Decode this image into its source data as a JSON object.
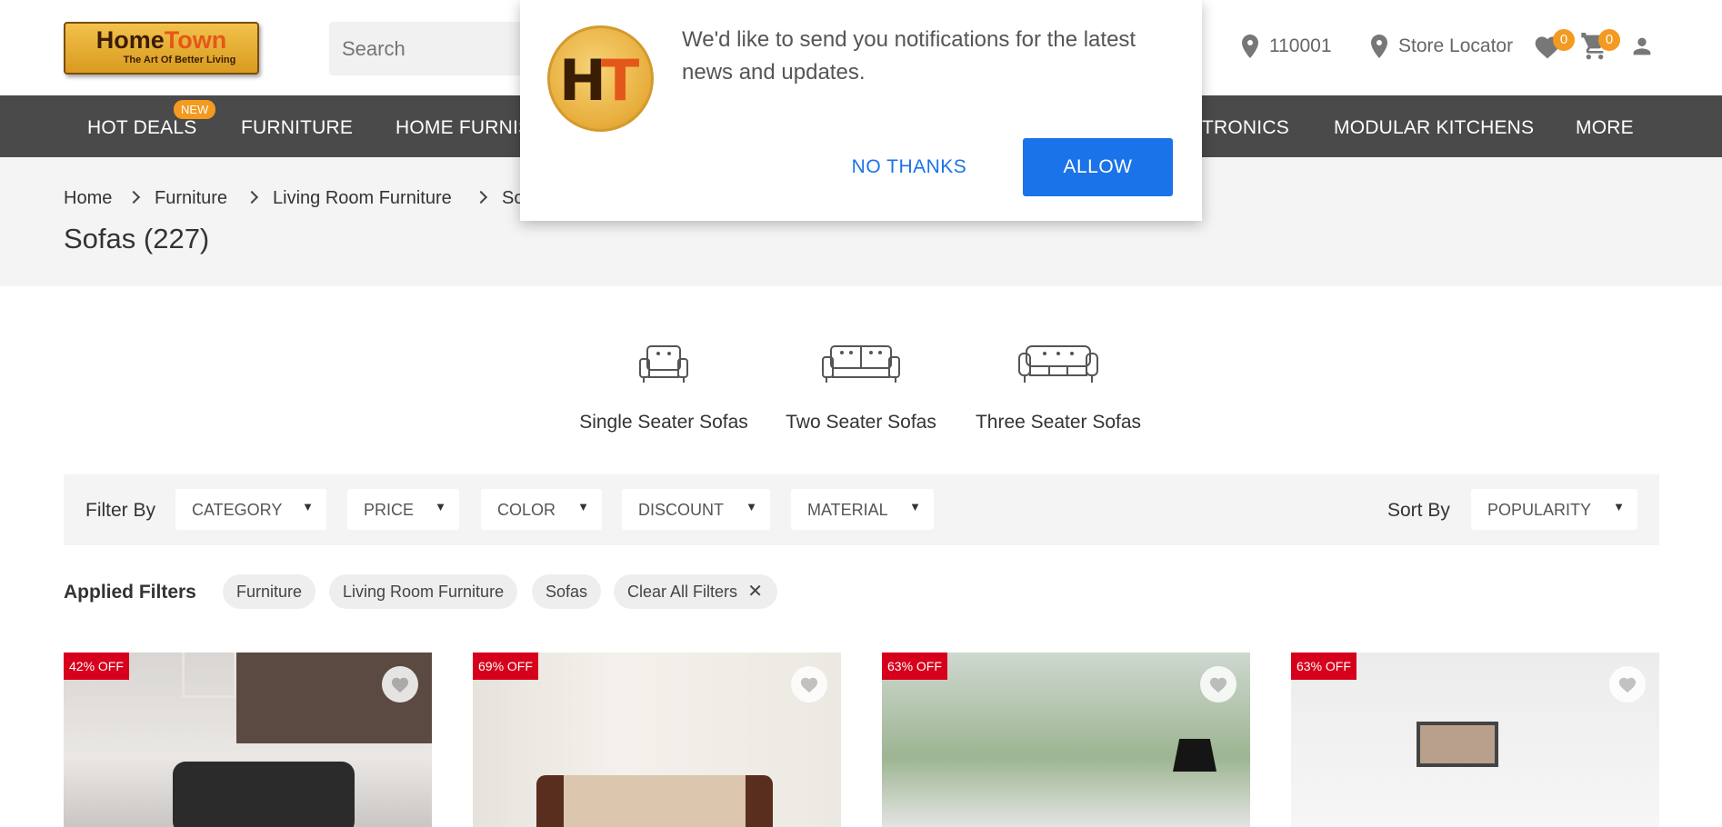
{
  "header": {
    "logo_title_a": "Home",
    "logo_title_b": "Town",
    "logo_tagline": "The Art Of Better Living",
    "search_placeholder": "Search",
    "pincode": "110001",
    "store_locator": "Store Locator",
    "wishlist_count": "0",
    "cart_count": "0"
  },
  "nav": {
    "items": [
      "HOT DEALS",
      "FURNITURE",
      "HOME FURNIS",
      "TRONICS",
      "MODULAR KITCHENS",
      "MORE"
    ],
    "new_badge": "NEW"
  },
  "breadcrumb": [
    "Home",
    "Furniture",
    "Living Room Furniture",
    "So"
  ],
  "page_title": "Sofas (227)",
  "categories": [
    "Single Seater Sofas",
    "Two Seater Sofas",
    "Three Seater Sofas"
  ],
  "filters": {
    "label": "Filter By",
    "options": [
      "CATEGORY",
      "PRICE",
      "COLOR",
      "DISCOUNT",
      "MATERIAL"
    ],
    "sort_label": "Sort By",
    "sort_value": "POPULARITY"
  },
  "applied": {
    "label": "Applied Filters",
    "chips": [
      "Furniture",
      "Living Room Furniture",
      "Sofas"
    ],
    "clear": "Clear All Filters"
  },
  "products": [
    {
      "discount": "42% OFF"
    },
    {
      "discount": "69% OFF"
    },
    {
      "discount": "63% OFF"
    },
    {
      "discount": "63% OFF"
    }
  ],
  "popup": {
    "message": "We'd like to send you notifications for the latest news and updates.",
    "logo_letters": [
      "H",
      "T"
    ],
    "no_thanks": "NO THANKS",
    "allow": "ALLOW"
  },
  "colors": {
    "nav_bg": "#4a4a4a",
    "accent_orange": "#f39a20",
    "discount_red": "#d6001c",
    "allow_blue": "#1a73e8"
  }
}
